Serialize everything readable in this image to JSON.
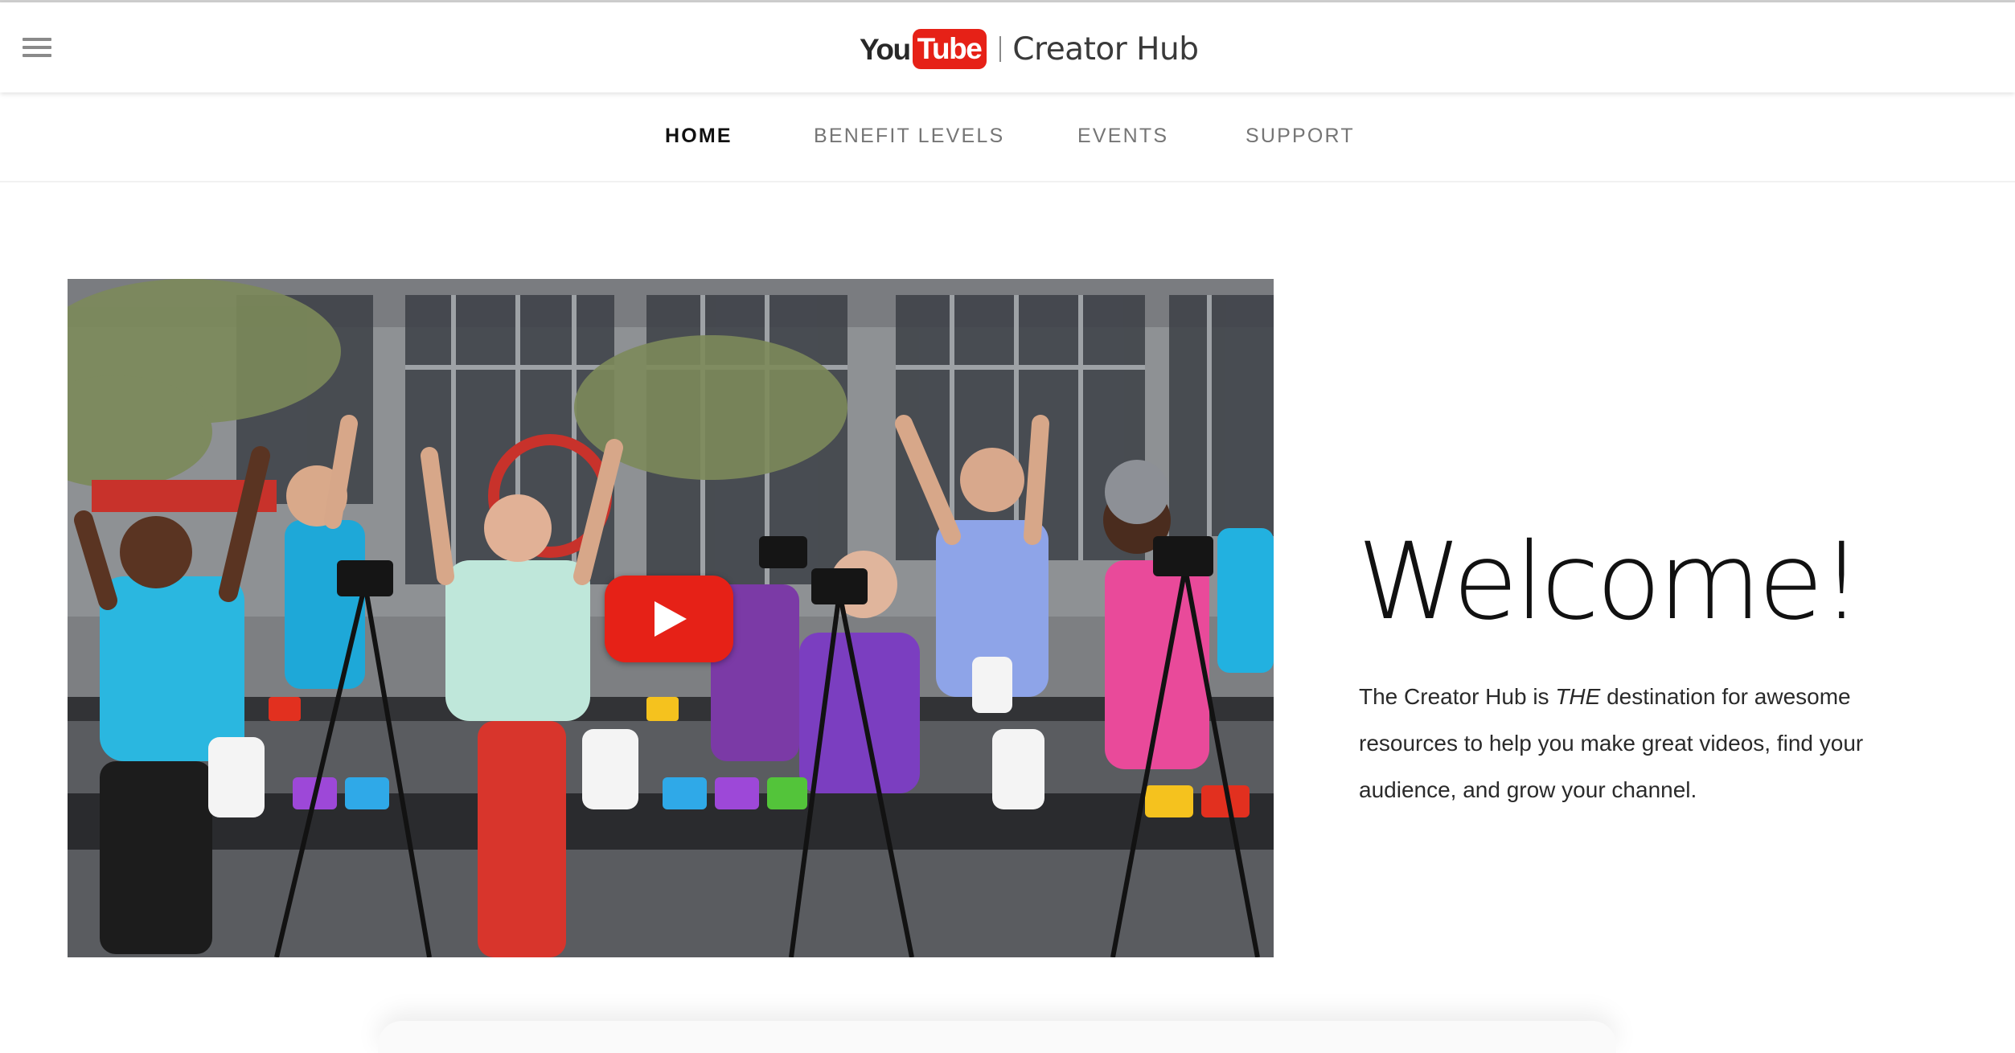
{
  "header": {
    "menu_icon": "hamburger-menu-icon",
    "logo": {
      "you": "You",
      "tube": "Tube"
    },
    "title": "Creator Hub"
  },
  "nav": {
    "items": [
      {
        "label": "HOME",
        "active": true
      },
      {
        "label": "BENEFIT LEVELS",
        "active": false
      },
      {
        "label": "EVENTS",
        "active": false
      },
      {
        "label": "SUPPORT",
        "active": false
      }
    ]
  },
  "hero": {
    "video_icon": "play-icon",
    "heading": "Welcome!",
    "description": {
      "before": "The Creator Hub is ",
      "emphasis": "THE",
      "after": " destination for awesome resources to help you make great videos, find your audience, and grow your channel."
    }
  },
  "colors": {
    "brand_red": "#e62117",
    "active_nav": "#111111",
    "inactive_nav": "#757575"
  }
}
